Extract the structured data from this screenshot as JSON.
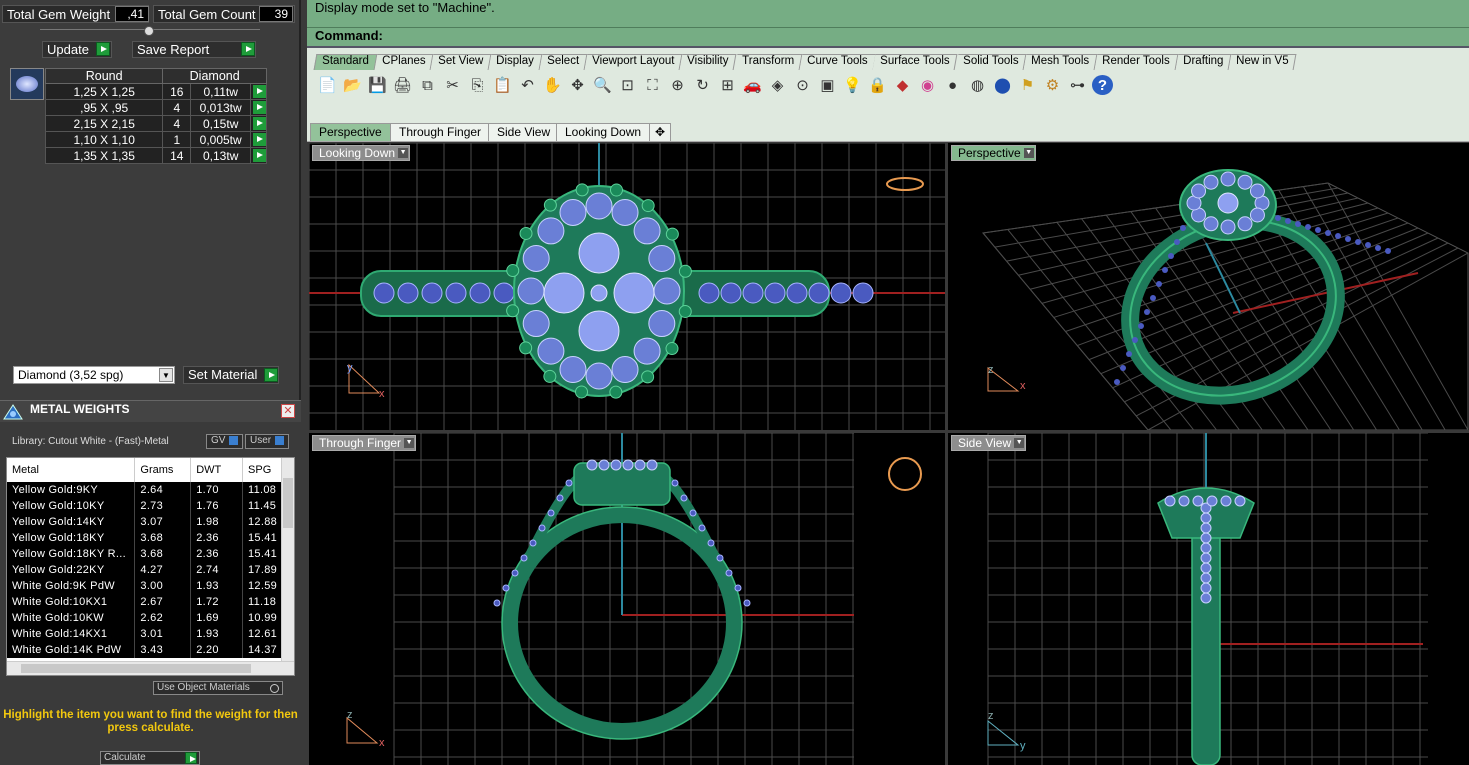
{
  "gem_panel": {
    "total_weight_label": "Total Gem Weight",
    "total_weight_value": ",41",
    "total_count_label": "Total Gem Count",
    "total_count_value": "39",
    "update_label": "Update",
    "save_report_label": "Save Report",
    "table_headers": [
      "Round",
      "Diamond"
    ],
    "rows": [
      {
        "size": "1,25 X 1,25",
        "count": "16",
        "weight": "0,11tw"
      },
      {
        "size": ",95 X ,95",
        "count": "4",
        "weight": "0,013tw"
      },
      {
        "size": "2,15 X 2,15",
        "count": "4",
        "weight": "0,15tw"
      },
      {
        "size": "1,10 X 1,10",
        "count": "1",
        "weight": "0,005tw"
      },
      {
        "size": "1,35 X 1,35",
        "count": "14",
        "weight": "0,13tw"
      }
    ],
    "material_select": "Diamond     (3,52 spg)",
    "set_material_label": "Set Material"
  },
  "metal_panel": {
    "title": "METAL WEIGHTS",
    "library": "Library: Cutout White - (Fast)-Metal",
    "gv_label": "GV",
    "user_label": "User",
    "headers": [
      "Metal",
      "Grams",
      "DWT",
      "SPG"
    ],
    "rows": [
      [
        "Yellow Gold:9KY",
        "2.64",
        "1.70",
        "11.08"
      ],
      [
        "Yellow Gold:10KY",
        "2.73",
        "1.76",
        "11.45"
      ],
      [
        "Yellow Gold:14KY",
        "3.07",
        "1.98",
        "12.88"
      ],
      [
        "Yellow Gold:18KY",
        "3.68",
        "2.36",
        "15.41"
      ],
      [
        "Yellow Gold:18KY R...",
        "3.68",
        "2.36",
        "15.41"
      ],
      [
        "Yellow Gold:22KY",
        "4.27",
        "2.74",
        "17.89"
      ],
      [
        "White Gold:9K PdW",
        "3.00",
        "1.93",
        "12.59"
      ],
      [
        "White Gold:10KX1",
        "2.67",
        "1.72",
        "11.18"
      ],
      [
        "White Gold:10KW",
        "2.62",
        "1.69",
        "10.99"
      ],
      [
        "White Gold:14KX1",
        "3.01",
        "1.93",
        "12.61"
      ],
      [
        "White Gold:14K PdW",
        "3.43",
        "2.20",
        "14.37"
      ]
    ],
    "use_object_materials": "Use Object Materials",
    "highlight_text": "Highlight the item you want to find the weight for then press calculate.",
    "calculate_label": "Calculate"
  },
  "status": {
    "message": "Display mode set to \"Machine\".",
    "command_label": "Command:"
  },
  "toolbar_tabs": [
    "Standard",
    "CPlanes",
    "Set View",
    "Display",
    "Select",
    "Viewport Layout",
    "Visibility",
    "Transform",
    "Curve Tools",
    "Surface Tools",
    "Solid Tools",
    "Mesh Tools",
    "Render Tools",
    "Drafting",
    "New in V5"
  ],
  "toolbar_icons": [
    "new-icon",
    "open-icon",
    "save-icon",
    "print-icon",
    "import-icon",
    "cut-icon",
    "copy-icon",
    "paste-icon",
    "undo-icon",
    "pan-hand-icon",
    "move-icon",
    "zoom-icon",
    "zoom-window-icon",
    "zoom-extents-icon",
    "zoom-selected-icon",
    "rotate-view-icon",
    "viewport-grid-icon",
    "car-icon",
    "layer-icon",
    "osnap-icon",
    "properties-icon",
    "light-icon",
    "lock-icon",
    "material-icon",
    "color-wheel-icon",
    "shaded-sphere-icon",
    "rendered-sphere-icon",
    "glossy-sphere-icon",
    "tools-icon",
    "settings-gear-icon",
    "network-icon",
    "help-icon"
  ],
  "view_tabs": [
    "Perspective",
    "Through Finger",
    "Side View",
    "Looking Down"
  ],
  "viewports": {
    "top_left": "Looking Down",
    "top_right": "Perspective",
    "bottom_left": "Through Finger",
    "bottom_right": "Side View"
  },
  "axis_labels": {
    "x": "x",
    "y": "y",
    "z": "z"
  },
  "colors": {
    "ring": "#1e7a5a",
    "gem": "#6a7fd6",
    "status_bg": "#76ad84",
    "grid": "#4a4a4a"
  }
}
